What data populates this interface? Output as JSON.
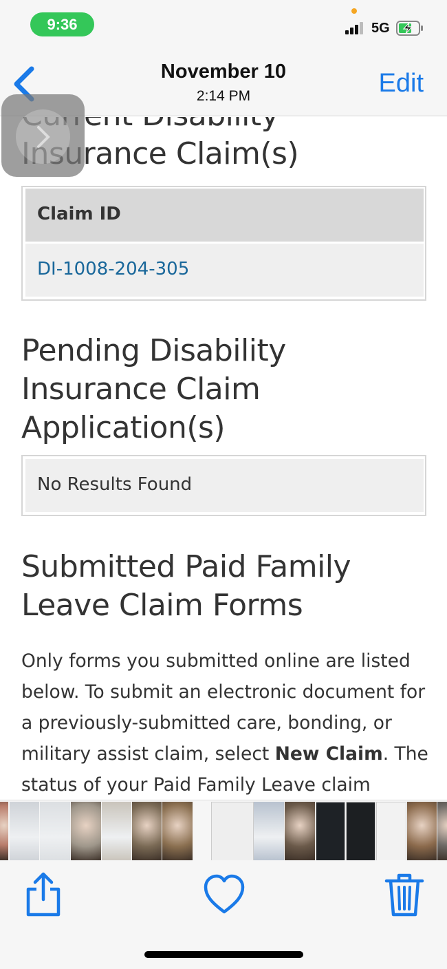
{
  "status_bar": {
    "time": "9:36",
    "network": "5G",
    "signal_bars_filled": 3,
    "signal_bars_total": 4,
    "battery_state": "charging"
  },
  "nav": {
    "back_icon": "chevron-left-icon",
    "date": "November 10",
    "time": "2:14 PM",
    "edit_label": "Edit"
  },
  "document": {
    "current_claims": {
      "title": "Current Disability Insurance Claim(s)",
      "column_header": "Claim ID",
      "claim_ids": [
        "DI-1008-204-305"
      ]
    },
    "pending_applications": {
      "title": "Pending Disability Insurance Claim Application(s)",
      "empty_text": "No Results Found"
    },
    "submitted_pfl_forms": {
      "title": "Submitted Paid Family Leave Claim Forms",
      "paragraph_part1": "Only forms you submitted online are listed below. To submit an electronic document for a previously-submitted care, bonding, or military assist claim, select ",
      "paragraph_bold": "New Claim",
      "paragraph_part2": ". The status of your Paid Family Leave claim"
    }
  },
  "overlay": {
    "icon": "chevron-right-icon"
  },
  "thumbnail_strip": {
    "thumbnails": [
      {
        "kind": "photo",
        "color": "#b87c6b"
      },
      {
        "kind": "document",
        "color": "#cfd3d8"
      },
      {
        "kind": "document",
        "color": "#dcdfe2"
      },
      {
        "kind": "photo",
        "color": "#9e968a"
      },
      {
        "kind": "document",
        "color": "#c9c4bb"
      },
      {
        "kind": "photo",
        "color": "#7a6a55"
      },
      {
        "kind": "photo",
        "color": "#8a6f50"
      },
      {
        "kind": "screenshot",
        "color": "#eeeeee",
        "selected": true
      },
      {
        "kind": "document",
        "color": "#b8c2cf"
      },
      {
        "kind": "photo",
        "color": "#6b5a4a"
      },
      {
        "kind": "screenshot",
        "color": "#1e2226"
      },
      {
        "kind": "screenshot",
        "color": "#1c1f22"
      },
      {
        "kind": "screenshot",
        "color": "#f2f2f2"
      },
      {
        "kind": "photo",
        "color": "#8b6a4c"
      },
      {
        "kind": "photo",
        "color": "#6e6a66"
      }
    ]
  },
  "toolbar": {
    "share_icon": "share-icon",
    "favorite_icon": "heart-icon",
    "delete_icon": "trash-icon"
  },
  "colors": {
    "accent": "#1a7ae8",
    "link": "#19679a",
    "status_pill": "#34c759"
  }
}
